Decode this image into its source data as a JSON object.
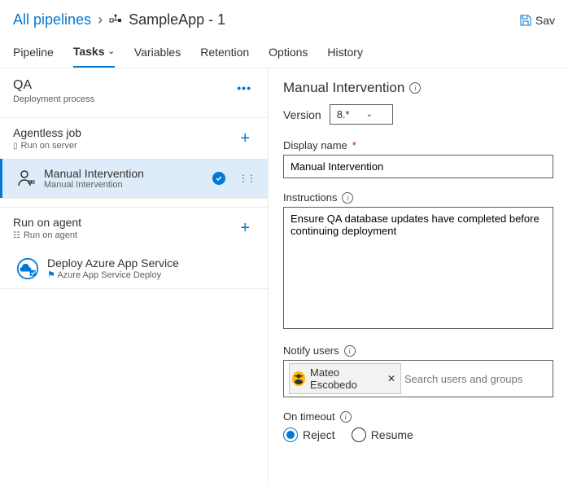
{
  "breadcrumb": {
    "root": "All pipelines",
    "current": "SampleApp - 1"
  },
  "toolbar": {
    "save_label": "Sav"
  },
  "tabs": {
    "pipeline": "Pipeline",
    "tasks": "Tasks",
    "variables": "Variables",
    "retention": "Retention",
    "options": "Options",
    "history": "History"
  },
  "stage": {
    "name": "QA",
    "sub": "Deployment process"
  },
  "jobs": [
    {
      "title": "Agentless job",
      "sub": "Run on server",
      "tasks": [
        {
          "name": "Manual Intervention",
          "sub": "Manual Intervention",
          "selected": true
        }
      ]
    },
    {
      "title": "Run on agent",
      "sub": "Run on agent",
      "tasks": [
        {
          "name": "Deploy Azure App Service",
          "sub": "Azure App Service Deploy",
          "selected": false
        }
      ]
    }
  ],
  "panel": {
    "title": "Manual Intervention",
    "version_label": "Version",
    "version_value": "8.*",
    "display_name_label": "Display name",
    "display_name_value": "Manual Intervention",
    "instructions_label": "Instructions",
    "instructions_value": "Ensure QA database updates have completed before continuing deployment",
    "notify_label": "Notify users",
    "notify_user": "Mateo Escobedo",
    "notify_placeholder": "Search users and groups",
    "timeout_label": "On timeout",
    "timeout_reject": "Reject",
    "timeout_resume": "Resume"
  }
}
